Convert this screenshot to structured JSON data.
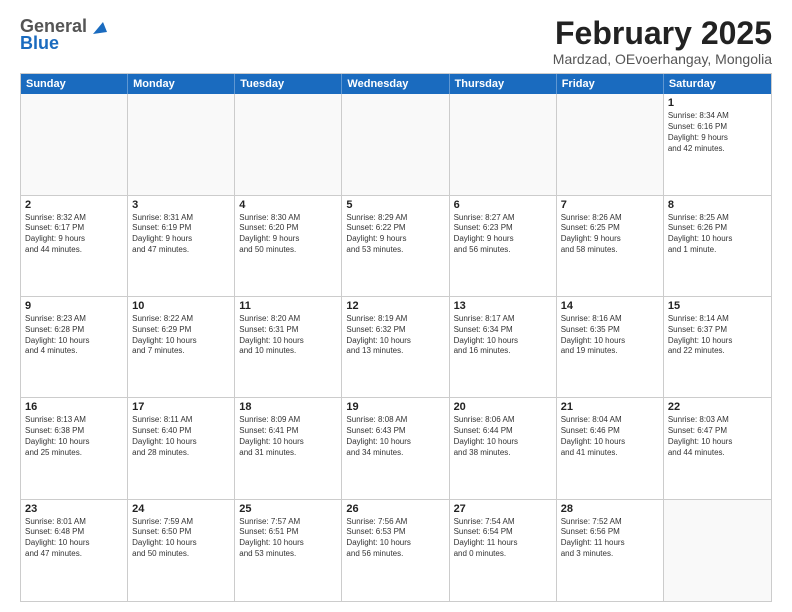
{
  "logo": {
    "line1": "General",
    "line2": "Blue"
  },
  "title": "February 2025",
  "subtitle": "Mardzad, OEvoerhangay, Mongolia",
  "days_of_week": [
    "Sunday",
    "Monday",
    "Tuesday",
    "Wednesday",
    "Thursday",
    "Friday",
    "Saturday"
  ],
  "weeks": [
    [
      {
        "day": "",
        "text": ""
      },
      {
        "day": "",
        "text": ""
      },
      {
        "day": "",
        "text": ""
      },
      {
        "day": "",
        "text": ""
      },
      {
        "day": "",
        "text": ""
      },
      {
        "day": "",
        "text": ""
      },
      {
        "day": "1",
        "text": "Sunrise: 8:34 AM\nSunset: 6:16 PM\nDaylight: 9 hours\nand 42 minutes."
      }
    ],
    [
      {
        "day": "2",
        "text": "Sunrise: 8:32 AM\nSunset: 6:17 PM\nDaylight: 9 hours\nand 44 minutes."
      },
      {
        "day": "3",
        "text": "Sunrise: 8:31 AM\nSunset: 6:19 PM\nDaylight: 9 hours\nand 47 minutes."
      },
      {
        "day": "4",
        "text": "Sunrise: 8:30 AM\nSunset: 6:20 PM\nDaylight: 9 hours\nand 50 minutes."
      },
      {
        "day": "5",
        "text": "Sunrise: 8:29 AM\nSunset: 6:22 PM\nDaylight: 9 hours\nand 53 minutes."
      },
      {
        "day": "6",
        "text": "Sunrise: 8:27 AM\nSunset: 6:23 PM\nDaylight: 9 hours\nand 56 minutes."
      },
      {
        "day": "7",
        "text": "Sunrise: 8:26 AM\nSunset: 6:25 PM\nDaylight: 9 hours\nand 58 minutes."
      },
      {
        "day": "8",
        "text": "Sunrise: 8:25 AM\nSunset: 6:26 PM\nDaylight: 10 hours\nand 1 minute."
      }
    ],
    [
      {
        "day": "9",
        "text": "Sunrise: 8:23 AM\nSunset: 6:28 PM\nDaylight: 10 hours\nand 4 minutes."
      },
      {
        "day": "10",
        "text": "Sunrise: 8:22 AM\nSunset: 6:29 PM\nDaylight: 10 hours\nand 7 minutes."
      },
      {
        "day": "11",
        "text": "Sunrise: 8:20 AM\nSunset: 6:31 PM\nDaylight: 10 hours\nand 10 minutes."
      },
      {
        "day": "12",
        "text": "Sunrise: 8:19 AM\nSunset: 6:32 PM\nDaylight: 10 hours\nand 13 minutes."
      },
      {
        "day": "13",
        "text": "Sunrise: 8:17 AM\nSunset: 6:34 PM\nDaylight: 10 hours\nand 16 minutes."
      },
      {
        "day": "14",
        "text": "Sunrise: 8:16 AM\nSunset: 6:35 PM\nDaylight: 10 hours\nand 19 minutes."
      },
      {
        "day": "15",
        "text": "Sunrise: 8:14 AM\nSunset: 6:37 PM\nDaylight: 10 hours\nand 22 minutes."
      }
    ],
    [
      {
        "day": "16",
        "text": "Sunrise: 8:13 AM\nSunset: 6:38 PM\nDaylight: 10 hours\nand 25 minutes."
      },
      {
        "day": "17",
        "text": "Sunrise: 8:11 AM\nSunset: 6:40 PM\nDaylight: 10 hours\nand 28 minutes."
      },
      {
        "day": "18",
        "text": "Sunrise: 8:09 AM\nSunset: 6:41 PM\nDaylight: 10 hours\nand 31 minutes."
      },
      {
        "day": "19",
        "text": "Sunrise: 8:08 AM\nSunset: 6:43 PM\nDaylight: 10 hours\nand 34 minutes."
      },
      {
        "day": "20",
        "text": "Sunrise: 8:06 AM\nSunset: 6:44 PM\nDaylight: 10 hours\nand 38 minutes."
      },
      {
        "day": "21",
        "text": "Sunrise: 8:04 AM\nSunset: 6:46 PM\nDaylight: 10 hours\nand 41 minutes."
      },
      {
        "day": "22",
        "text": "Sunrise: 8:03 AM\nSunset: 6:47 PM\nDaylight: 10 hours\nand 44 minutes."
      }
    ],
    [
      {
        "day": "23",
        "text": "Sunrise: 8:01 AM\nSunset: 6:48 PM\nDaylight: 10 hours\nand 47 minutes."
      },
      {
        "day": "24",
        "text": "Sunrise: 7:59 AM\nSunset: 6:50 PM\nDaylight: 10 hours\nand 50 minutes."
      },
      {
        "day": "25",
        "text": "Sunrise: 7:57 AM\nSunset: 6:51 PM\nDaylight: 10 hours\nand 53 minutes."
      },
      {
        "day": "26",
        "text": "Sunrise: 7:56 AM\nSunset: 6:53 PM\nDaylight: 10 hours\nand 56 minutes."
      },
      {
        "day": "27",
        "text": "Sunrise: 7:54 AM\nSunset: 6:54 PM\nDaylight: 11 hours\nand 0 minutes."
      },
      {
        "day": "28",
        "text": "Sunrise: 7:52 AM\nSunset: 6:56 PM\nDaylight: 11 hours\nand 3 minutes."
      },
      {
        "day": "",
        "text": ""
      }
    ]
  ]
}
